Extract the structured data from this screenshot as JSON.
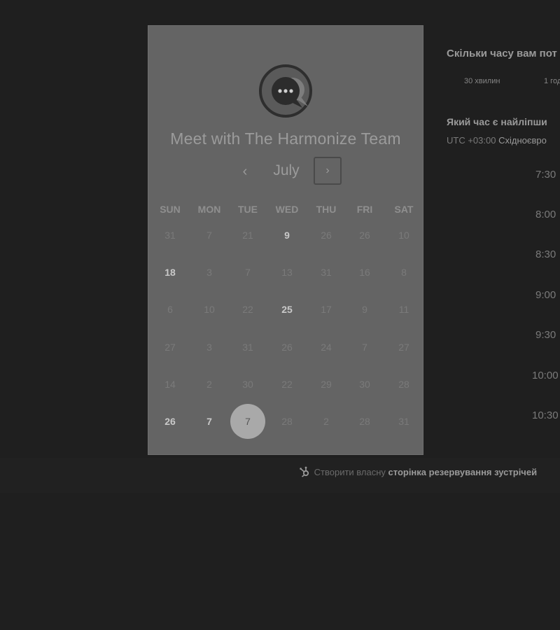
{
  "meeting_title": "Meet with The Harmonize Team",
  "calendar": {
    "month": "July",
    "prev_icon": "chevron-left-icon",
    "next_icon": "chevron-right-icon",
    "weekdays": [
      "SUN",
      "MON",
      "TUE",
      "WED",
      "THU",
      "FRI",
      "SAT"
    ],
    "weeks": [
      [
        {
          "d": "31",
          "a": false
        },
        {
          "d": "7",
          "a": false
        },
        {
          "d": "21",
          "a": false
        },
        {
          "d": "9",
          "a": true
        },
        {
          "d": "26",
          "a": false
        },
        {
          "d": "26",
          "a": false
        },
        {
          "d": "10",
          "a": false
        }
      ],
      [
        {
          "d": "18",
          "a": true
        },
        {
          "d": "3",
          "a": false
        },
        {
          "d": "7",
          "a": false
        },
        {
          "d": "13",
          "a": false
        },
        {
          "d": "31",
          "a": false
        },
        {
          "d": "16",
          "a": false
        },
        {
          "d": "8",
          "a": false
        }
      ],
      [
        {
          "d": "6",
          "a": false
        },
        {
          "d": "10",
          "a": false
        },
        {
          "d": "22",
          "a": false
        },
        {
          "d": "25",
          "a": true
        },
        {
          "d": "17",
          "a": false
        },
        {
          "d": "9",
          "a": false
        },
        {
          "d": "11",
          "a": false
        }
      ],
      [
        {
          "d": "27",
          "a": false
        },
        {
          "d": "3",
          "a": false
        },
        {
          "d": "31",
          "a": false
        },
        {
          "d": "26",
          "a": false
        },
        {
          "d": "24",
          "a": false
        },
        {
          "d": "7",
          "a": false
        },
        {
          "d": "27",
          "a": false
        }
      ],
      [
        {
          "d": "14",
          "a": false
        },
        {
          "d": "2",
          "a": false
        },
        {
          "d": "30",
          "a": false
        },
        {
          "d": "22",
          "a": false
        },
        {
          "d": "29",
          "a": false
        },
        {
          "d": "30",
          "a": false
        },
        {
          "d": "28",
          "a": false
        }
      ],
      [
        {
          "d": "26",
          "a": true
        },
        {
          "d": "7",
          "a": true
        },
        {
          "d": "7",
          "a": true,
          "selected": true
        },
        {
          "d": "28",
          "a": false
        },
        {
          "d": "2",
          "a": false
        },
        {
          "d": "28",
          "a": false
        },
        {
          "d": "31",
          "a": false
        }
      ]
    ]
  },
  "right": {
    "duration_question": "Скільки часу вам пот",
    "duration_options": [
      "30 хвилин",
      "1 год"
    ],
    "time_question": "Який час є найліпши",
    "timezone_offset": "UTC +03:00",
    "timezone_name": "Східноєвро",
    "time_slots": [
      "7:30",
      "8:00",
      "8:30",
      "9:00",
      "9:30",
      "10:00",
      "10:30"
    ]
  },
  "footer": {
    "prefix": "Створити власну",
    "link": "сторінка резервування зустрічей",
    "icon": "hubspot-sprocket-icon"
  },
  "colors": {
    "page_bg": "#1f1f1f",
    "card_bg": "#646464",
    "selected_day": "#a9a9a9"
  }
}
